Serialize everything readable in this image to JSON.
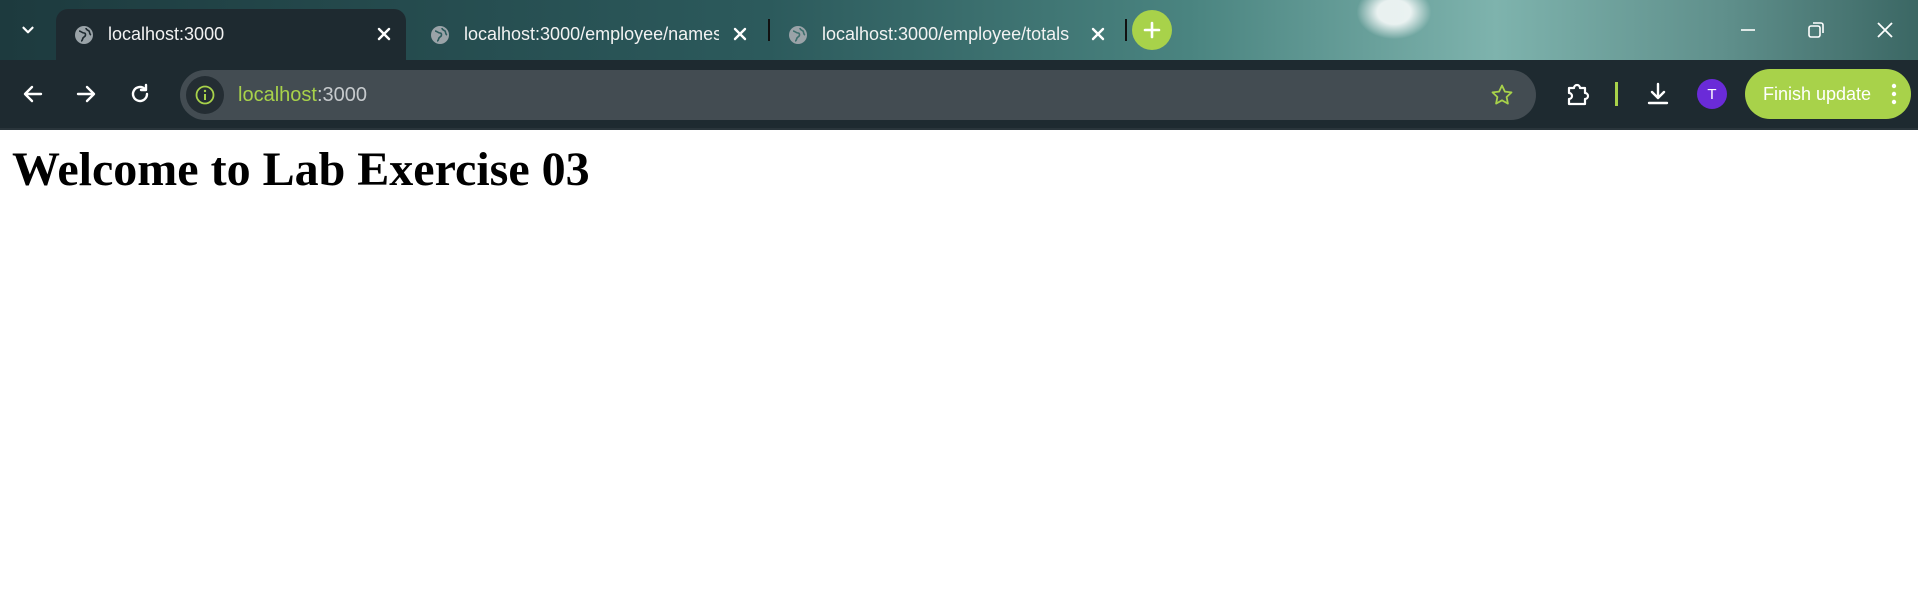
{
  "browser": {
    "tabs": [
      {
        "title": "localhost:3000",
        "active": true
      },
      {
        "title": "localhost:3000/employee/names",
        "active": false
      },
      {
        "title": "localhost:3000/employee/totals",
        "active": false
      }
    ],
    "address": {
      "host": "localhost",
      "rest": ":3000"
    },
    "profile_initial": "T",
    "update_button_label": "Finish update",
    "colors": {
      "accent": "#a8d24a",
      "toolbar": "#1e2a30",
      "omnibox": "#434c52",
      "avatar": "#6a2bd8"
    }
  },
  "page": {
    "heading": "Welcome to Lab Exercise 03"
  }
}
